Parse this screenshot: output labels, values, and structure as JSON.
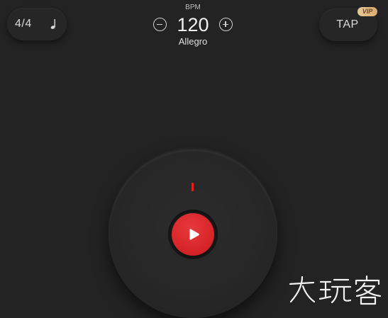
{
  "header": {
    "time_signature": "4/4",
    "bpm_caption": "BPM",
    "bpm_value": "120",
    "tempo_name": "Allegro",
    "tap_label": "TAP",
    "vip_label": "VIP"
  },
  "icons": {
    "note": "quarter-note-icon",
    "minus": "minus-circle-icon",
    "plus": "plus-circle-icon",
    "play": "play-icon"
  },
  "colors": {
    "background": "#232323",
    "accent_red": "#d8262a",
    "beat_marker": "#e0201f",
    "vip_gold": "#e2bb85"
  },
  "watermark": {
    "text": "大玩客"
  }
}
